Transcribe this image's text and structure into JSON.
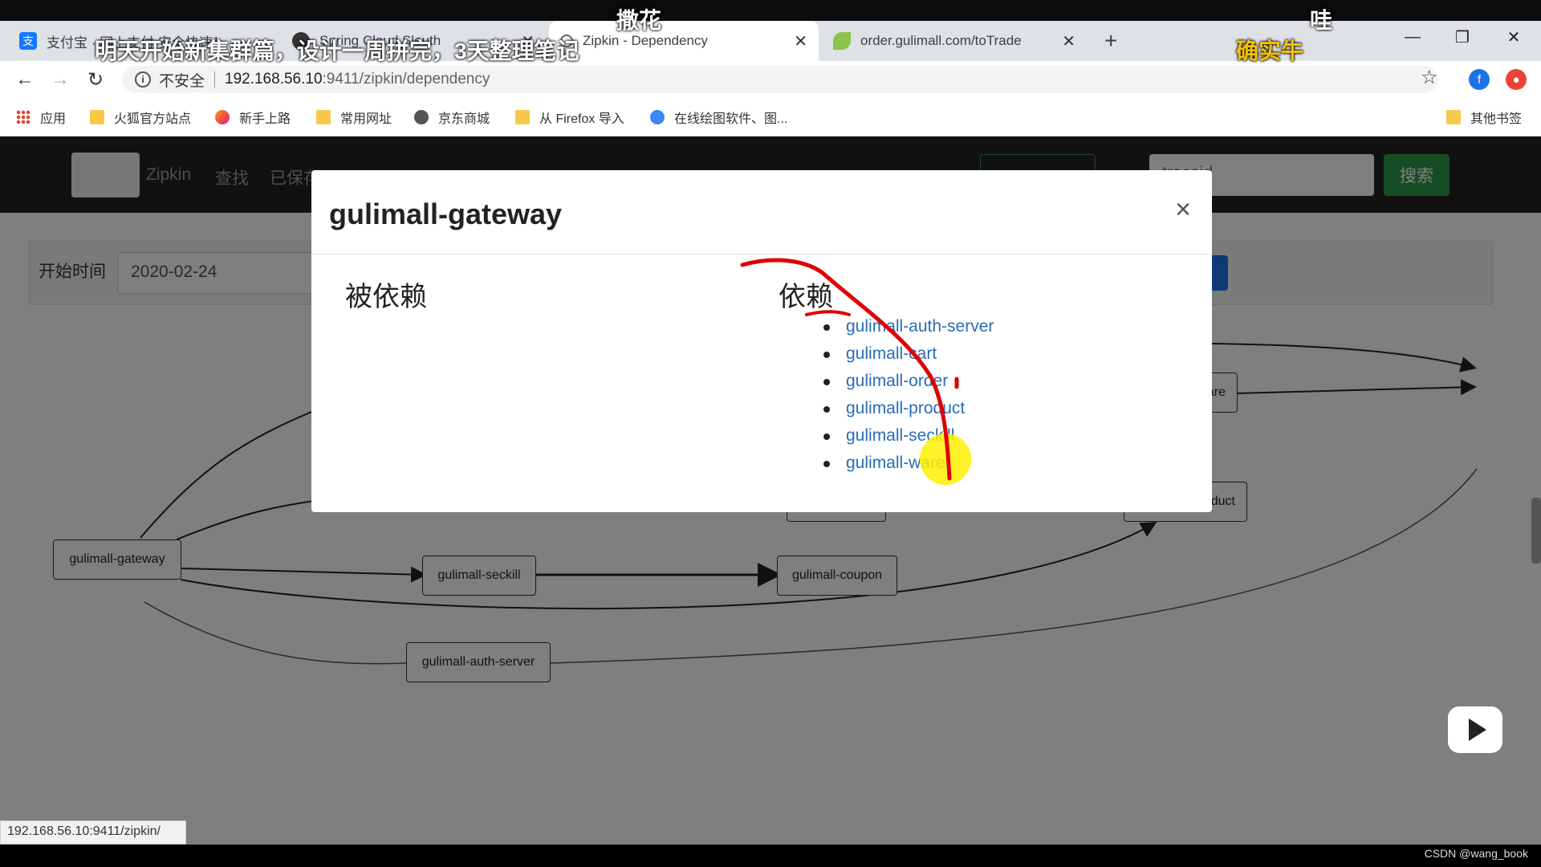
{
  "tabs": [
    {
      "label": "支付宝 · 网上支付 安全快速！",
      "icon": "alipay-icon",
      "color": "#1677ff"
    },
    {
      "label": "Spring Cloud Sleuth",
      "icon": "github-icon",
      "color": "#333333"
    },
    {
      "label": "Zipkin - Dependency",
      "icon": "zipkin-icon",
      "color": "#666666",
      "active": true
    },
    {
      "label": "order.gulimall.com/toTrade",
      "icon": "leaf-icon",
      "color": "#8bc34a"
    }
  ],
  "address": {
    "security": "不安全",
    "host": "192.168.56.10",
    "path": ":9411/zipkin/dependency"
  },
  "bookmarks": [
    "应用",
    "火狐官方站点",
    "新手上路",
    "常用网址",
    "京东商城",
    "从 Firefox 导入",
    "在线绘图软件、图...",
    "其他书签"
  ],
  "zipkin": {
    "brand": "Zipkin",
    "nav": [
      "查找",
      "已保存"
    ],
    "trace_placeholder": "traceid",
    "search_label": "搜索",
    "start_time_label": "开始时间",
    "start_time_value": "2020-02-24"
  },
  "graph": {
    "nodes": [
      "gulimall-gateway",
      "gulimall-seckill",
      "gulimall-coupon",
      "gulimall-auth-server",
      "ware",
      "duct"
    ]
  },
  "modal": {
    "title": "gulimall-gateway",
    "close": "×",
    "depended_by_label": "被依赖",
    "depends_on_label": "依赖",
    "dependencies": [
      "gulimall-auth-server",
      "gulimall-cart",
      "gulimall-order",
      "gulimall-product",
      "gulimall-seckill",
      "gulimall-ware"
    ]
  },
  "overlay_text": {
    "subtitle_main": "明天开始新集群篇，设计一周拼完，3天整理笔记",
    "danmaku_1": "撒花",
    "danmaku_2": "哇",
    "danmaku_3": "确实牛"
  },
  "status_url": "192.168.56.10:9411/zipkin/",
  "watermark": "CSDN @wang_book",
  "colors": {
    "link": "#2a6bb8",
    "search_green": "#2e9a4a",
    "annotation_red": "#e00000",
    "cursor_yellow": "#fff000"
  }
}
